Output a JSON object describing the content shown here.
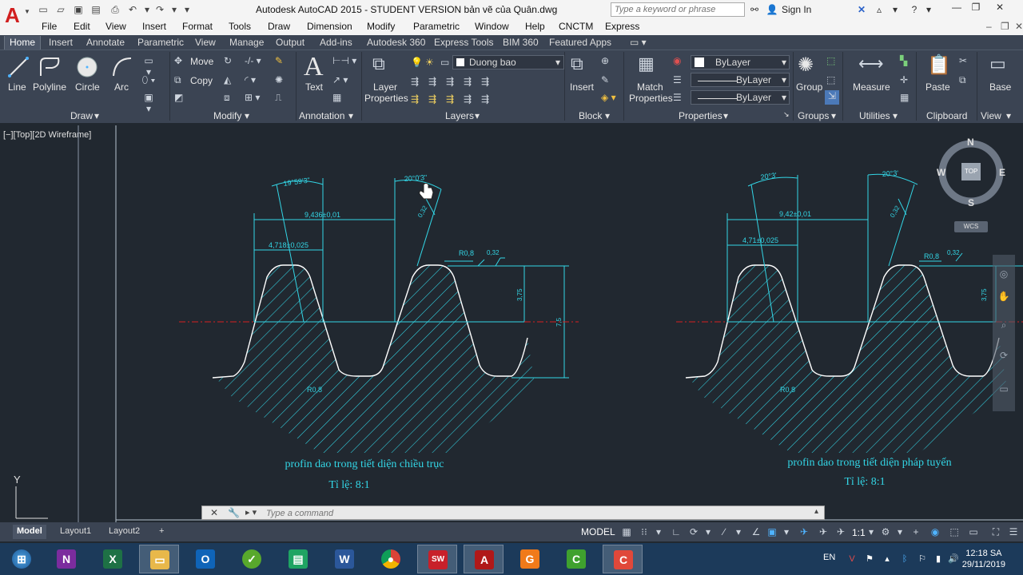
{
  "app": {
    "title": "Autodesk AutoCAD 2015 - STUDENT VERSION    bản vẽ của Quân.dwg",
    "search_placeholder": "Type a keyword or phrase",
    "sign_in": "Sign In"
  },
  "menu": [
    "File",
    "Edit",
    "View",
    "Insert",
    "Format",
    "Tools",
    "Draw",
    "Dimension",
    "Modify",
    "Parametric",
    "Window",
    "Help",
    "CNCTM",
    "Express"
  ],
  "ribbon_tabs": [
    "Home",
    "Insert",
    "Annotate",
    "Parametric",
    "View",
    "Manage",
    "Output",
    "Add-ins",
    "Autodesk 360",
    "Express Tools",
    "BIM 360",
    "Featured Apps"
  ],
  "ribbon": {
    "draw": {
      "line": "Line",
      "polyline": "Polyline",
      "circle": "Circle",
      "arc": "Arc",
      "title": "Draw"
    },
    "modify": {
      "move": "Move",
      "copy": "Copy",
      "title": "Modify"
    },
    "annotation": {
      "text": "Text",
      "title": "Annotation"
    },
    "layers": {
      "layer_properties_1": "Layer",
      "layer_properties_2": "Properties",
      "current_layer": "Duong bao",
      "title": "Layers"
    },
    "block": {
      "insert": "Insert",
      "title": "Block"
    },
    "properties": {
      "match_1": "Match",
      "match_2": "Properties",
      "color": "ByLayer",
      "linetype": "ByLayer",
      "lineweight": "ByLayer",
      "title": "Properties"
    },
    "groups": {
      "group": "Group",
      "title": "Groups"
    },
    "utilities": {
      "measure": "Measure",
      "title": "Utilities"
    },
    "clipboard": {
      "paste": "Paste",
      "title": "Clipboard"
    },
    "view": {
      "base": "Base",
      "title": "View"
    }
  },
  "viewport": {
    "label": "[−][Top][2D Wireframe]",
    "compass": {
      "n": "N",
      "s": "S",
      "e": "E",
      "w": "W",
      "top": "TOP"
    },
    "wcs": "WCS",
    "ucs_y": "Y"
  },
  "drawing1": {
    "angle_left": "19°59'3\"",
    "angle_right": "20°0'3\"",
    "dim_9436": "9,436±0,01",
    "dim_4718": "4,718±0,025",
    "tol_032a": "0,32",
    "r08_top": "R0,8",
    "tol_032b": "0,32",
    "dim_375": "3,75",
    "dim_75": "7,5",
    "r08_bottom": "R0,8",
    "caption": "profin dao trong tiết diện chiều trục",
    "scale": "Tỉ lệ: 8:1"
  },
  "drawing2": {
    "angle_left": "20°3'",
    "angle_right": "20°3'",
    "dim_942": "9,42±0,01",
    "dim_471": "4,71±0,025",
    "tol_032a": "0,32",
    "r08_top": "R0,8",
    "tol_032b": "0,32",
    "dim_375": "3,75",
    "r08_bottom": "R0,8",
    "caption": "profin dao trong tiết diện pháp tuyến",
    "scale": "Tỉ lệ: 8:1"
  },
  "command_line": {
    "placeholder": "Type a command"
  },
  "layout_tabs": [
    "Model",
    "Layout1",
    "Layout2"
  ],
  "status": {
    "model": "MODEL",
    "scale": "1:1"
  },
  "taskbar": {
    "lang": "EN",
    "time": "12:18 SA",
    "date": "29/11/2019",
    "apps": [
      "start",
      "onenote",
      "excel",
      "explorer",
      "outlook",
      "app-green",
      "sheets",
      "word",
      "chrome",
      "solidworks",
      "autocad",
      "foxit",
      "camtasia-green",
      "camtasia-red"
    ]
  },
  "colors": {
    "canvas": "#212830",
    "cyan": "#33d6e6",
    "white": "#ffffff",
    "red_center": "#d62020",
    "ribbon": "#3b4453"
  }
}
